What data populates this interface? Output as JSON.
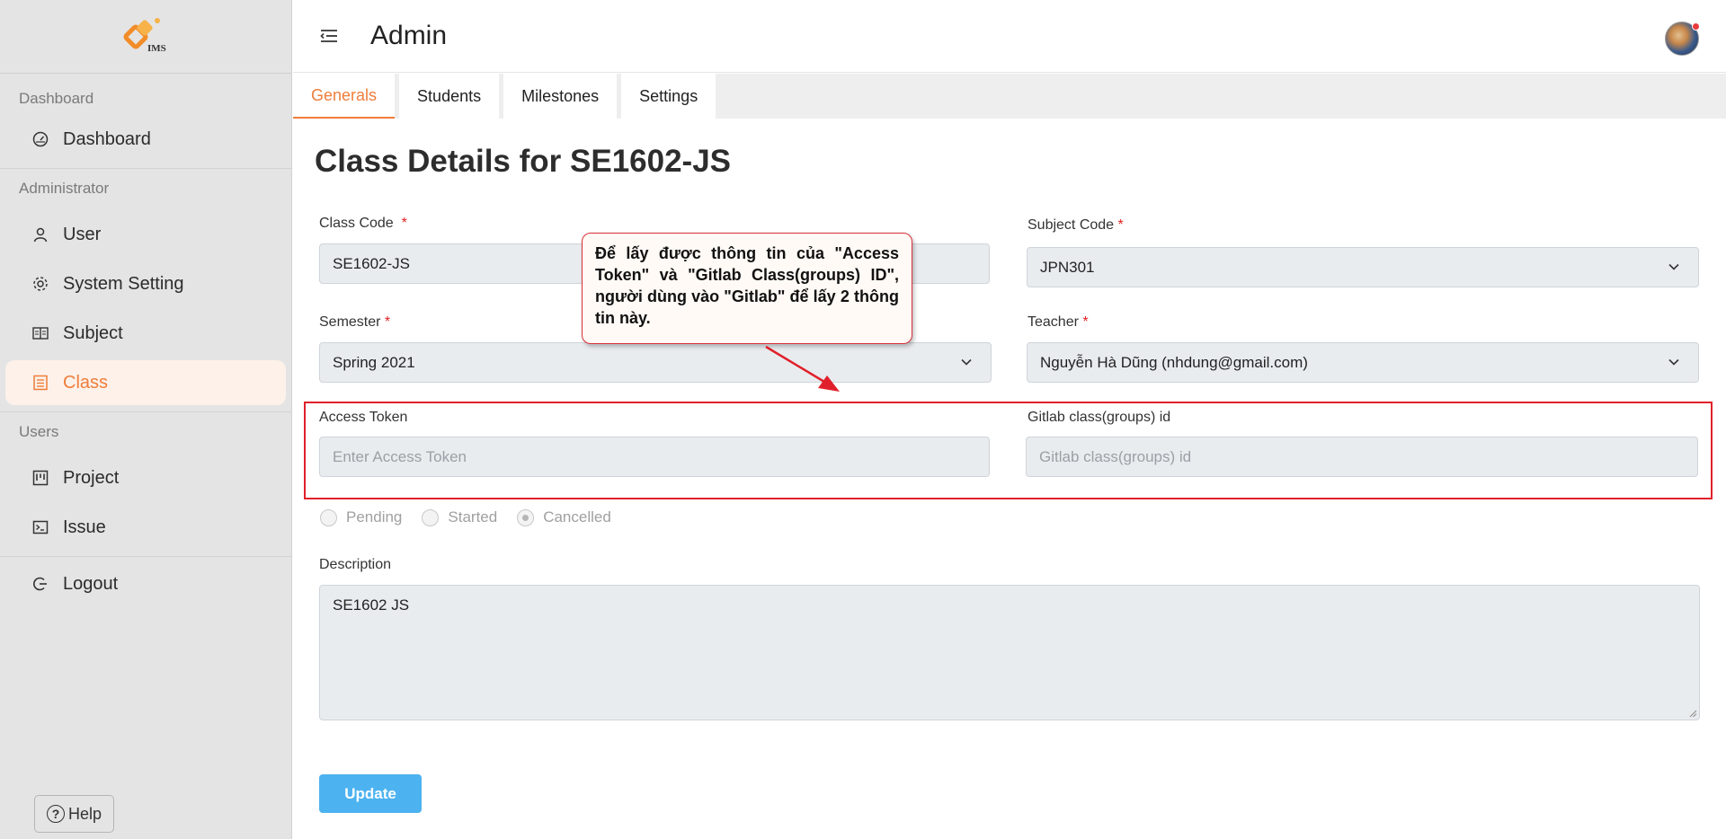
{
  "app": {
    "logo_text": "IMS",
    "header_title": "Admin"
  },
  "sidebar": {
    "sections": [
      {
        "label": "Dashboard",
        "items": [
          {
            "label": "Dashboard",
            "icon": "dashboard-gauge-icon"
          }
        ]
      },
      {
        "label": "Administrator",
        "items": [
          {
            "label": "User",
            "icon": "user-icon"
          },
          {
            "label": "System Setting",
            "icon": "gear-icon"
          },
          {
            "label": "Subject",
            "icon": "book-icon"
          },
          {
            "label": "Class",
            "icon": "class-icon",
            "active": true
          }
        ]
      },
      {
        "label": "Users",
        "items": [
          {
            "label": "Project",
            "icon": "project-board-icon"
          },
          {
            "label": "Issue",
            "icon": "terminal-icon"
          }
        ]
      }
    ],
    "logout_label": "Logout",
    "help_label": "Help"
  },
  "tabs": [
    "Generals",
    "Students",
    "Milestones",
    "Settings"
  ],
  "active_tab": "Generals",
  "main": {
    "title": "Class Details for SE1602-JS",
    "class_code": {
      "label": "Class Code",
      "value": "SE1602-JS"
    },
    "subject_code": {
      "label": "Subject Code",
      "value": "JPN301"
    },
    "semester": {
      "label": "Semester",
      "value": "Spring 2021"
    },
    "teacher": {
      "label": "Teacher",
      "value": "Nguyễn Hà Dũng (nhdung@gmail.com)"
    },
    "access_token": {
      "label": "Access Token",
      "placeholder": "Enter Access Token"
    },
    "gitlab_id": {
      "label": "Gitlab class(groups) id",
      "placeholder": "Gitlab class(groups) id"
    },
    "status_options": [
      {
        "label": "Pending",
        "checked": false
      },
      {
        "label": "Started",
        "checked": false
      },
      {
        "label": "Cancelled",
        "checked": true
      }
    ],
    "description": {
      "label": "Description",
      "value": "SE1602 JS"
    },
    "update_label": "Update"
  },
  "annotation": {
    "callout_text": "Để lấy được thông tin của \"Access Token\" và \"Gitlab Class(groups) ID\", người dùng vào \"Gitlab\" để lấy 2 thông tin này.",
    "highlight_color": "#e0202a"
  },
  "colors": {
    "accent": "#ef7d3a",
    "button": "#4db3f0",
    "required": "#e02020"
  }
}
